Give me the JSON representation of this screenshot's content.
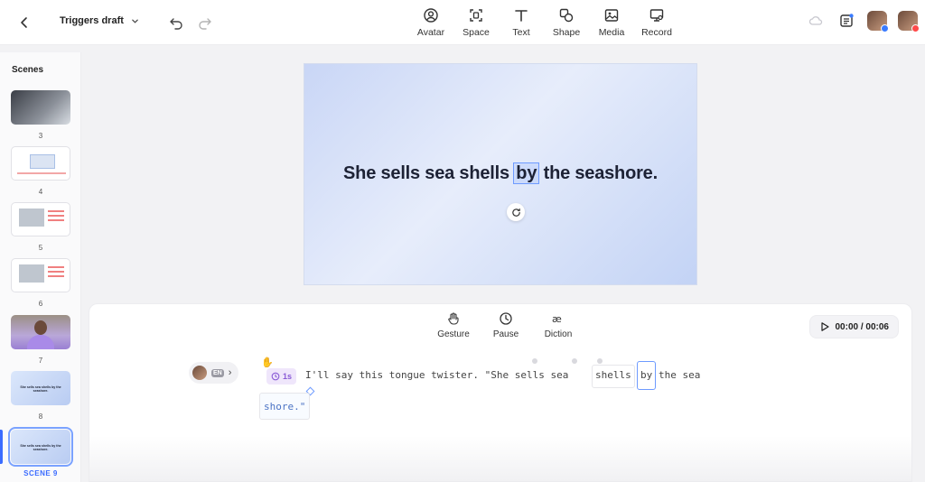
{
  "header": {
    "draft_title": "Triggers draft",
    "tools": [
      {
        "label": "Avatar",
        "icon": "avatar-icon"
      },
      {
        "label": "Space",
        "icon": "space-icon"
      },
      {
        "label": "Text",
        "icon": "text-icon"
      },
      {
        "label": "Shape",
        "icon": "shape-icon"
      },
      {
        "label": "Media",
        "icon": "media-icon"
      },
      {
        "label": "Record",
        "icon": "record-icon"
      }
    ]
  },
  "sidebar": {
    "title": "Scenes",
    "scenes": [
      {
        "number": "3"
      },
      {
        "number": "4"
      },
      {
        "number": "5"
      },
      {
        "number": "6"
      },
      {
        "number": "7"
      },
      {
        "number": "8",
        "caption": "She sells sea shells by the seashore."
      },
      {
        "caption": "She sells sea shells by the seashore."
      }
    ],
    "active_label": "SCENE 9"
  },
  "canvas": {
    "before": "She sells sea shells ",
    "highlight": "by",
    "after": " the seashore."
  },
  "panel": {
    "tools": [
      {
        "label": "Gesture",
        "icon": "gesture-icon"
      },
      {
        "label": "Pause",
        "icon": "clock-icon"
      },
      {
        "label": "Diction",
        "icon": "diction-icon"
      }
    ],
    "playback": "00:00 / 00:06",
    "language": "EN",
    "pause_value": "1s",
    "script_line1": "I'll say this tongue twister. \"She sells sea ",
    "word_shells": "shells",
    "word_by": "by",
    "word_after": "the sea",
    "script_line2": "shore.\""
  }
}
